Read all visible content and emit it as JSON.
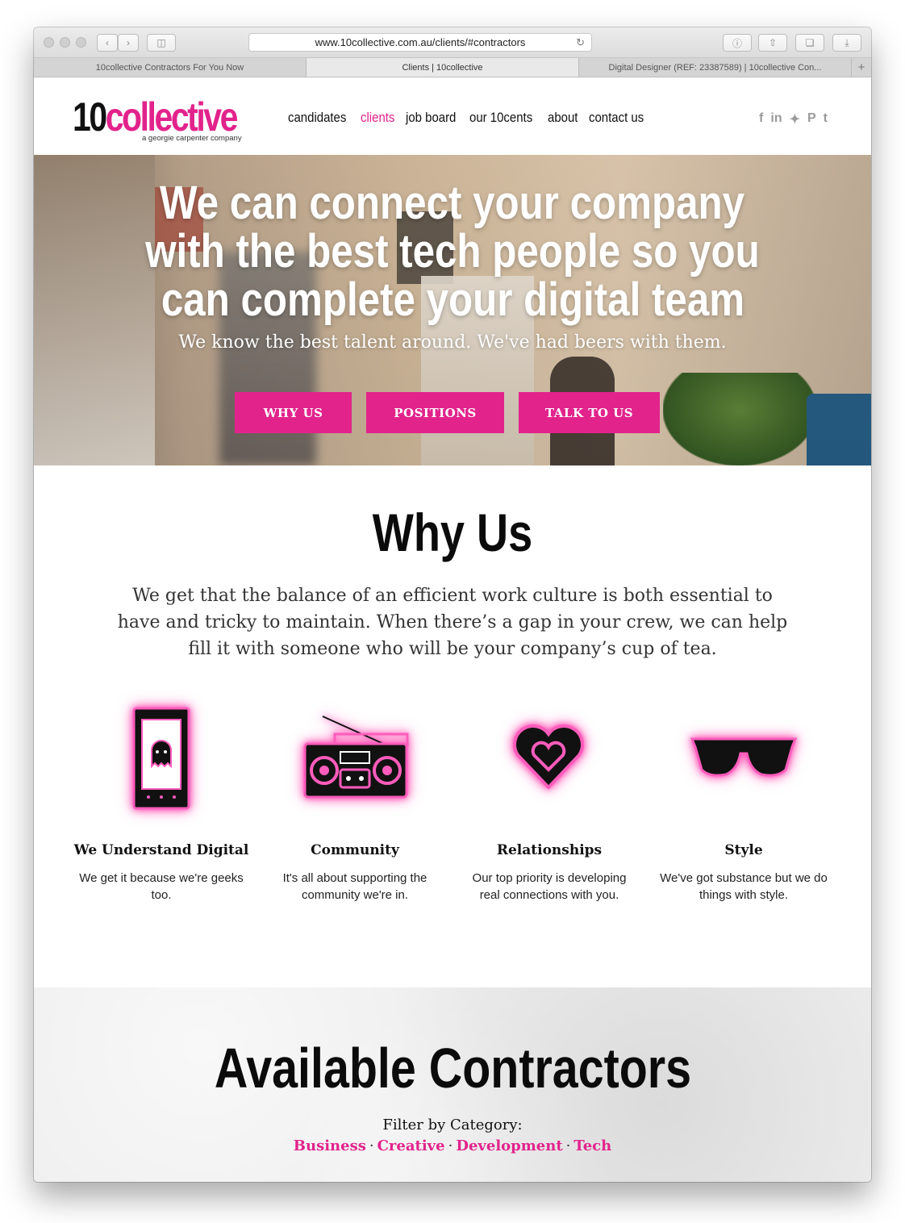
{
  "browser": {
    "url": "www.10collective.com.au/clients/#contractors",
    "tabs": [
      {
        "label": "10collective Contractors For You Now"
      },
      {
        "label": "Clients | 10collective"
      },
      {
        "label": "Digital Designer (REF: 23387589) | 10collective Con..."
      }
    ]
  },
  "header": {
    "logo_number": "10",
    "logo_word": "collective",
    "logo_tagline": "a georgie carpenter company",
    "nav": [
      {
        "label": "candidates"
      },
      {
        "label": "clients"
      },
      {
        "label": "job board"
      },
      {
        "label": "our 10cents"
      },
      {
        "label": "about"
      },
      {
        "label": "contact us"
      }
    ],
    "social_icons": [
      "facebook-icon",
      "linkedin-icon",
      "twitter-icon",
      "pinterest-icon",
      "tumblr-icon"
    ]
  },
  "hero": {
    "title_lines": [
      "We can connect your company",
      "with the best tech people so you",
      "can complete your digital team"
    ],
    "subtitle": "We know the best talent around. We've had beers with them.",
    "buttons": [
      {
        "label": "WHY US"
      },
      {
        "label": "POSITIONS"
      },
      {
        "label": "TALK TO US"
      }
    ]
  },
  "why_us": {
    "title": "Why Us",
    "text": "We get that the balance of an efficient work culture is both essential to have and tricky to maintain. When there’s a gap in your crew, we can help fill it with someone who will be your company’s cup of tea.",
    "features": [
      {
        "icon": "phone-ghost-icon",
        "title": "We Understand Digital",
        "text": "We get it because we're geeks too."
      },
      {
        "icon": "boombox-icon",
        "title": "Community",
        "text": "It's all about supporting the community we're in."
      },
      {
        "icon": "heart-icon",
        "title": "Relationships",
        "text": "Our top priority is developing real connections with you."
      },
      {
        "icon": "sunglasses-icon",
        "title": "Style",
        "text": "We've got substance but we do things with style."
      }
    ]
  },
  "contractors": {
    "title": "Available Contractors",
    "filter_label": "Filter by Category:",
    "categories": [
      {
        "label": "Business"
      },
      {
        "label": "Creative"
      },
      {
        "label": "Development"
      },
      {
        "label": "Tech"
      }
    ]
  },
  "colors": {
    "brand_pink": "#e2238c",
    "text_dark": "#111111"
  }
}
